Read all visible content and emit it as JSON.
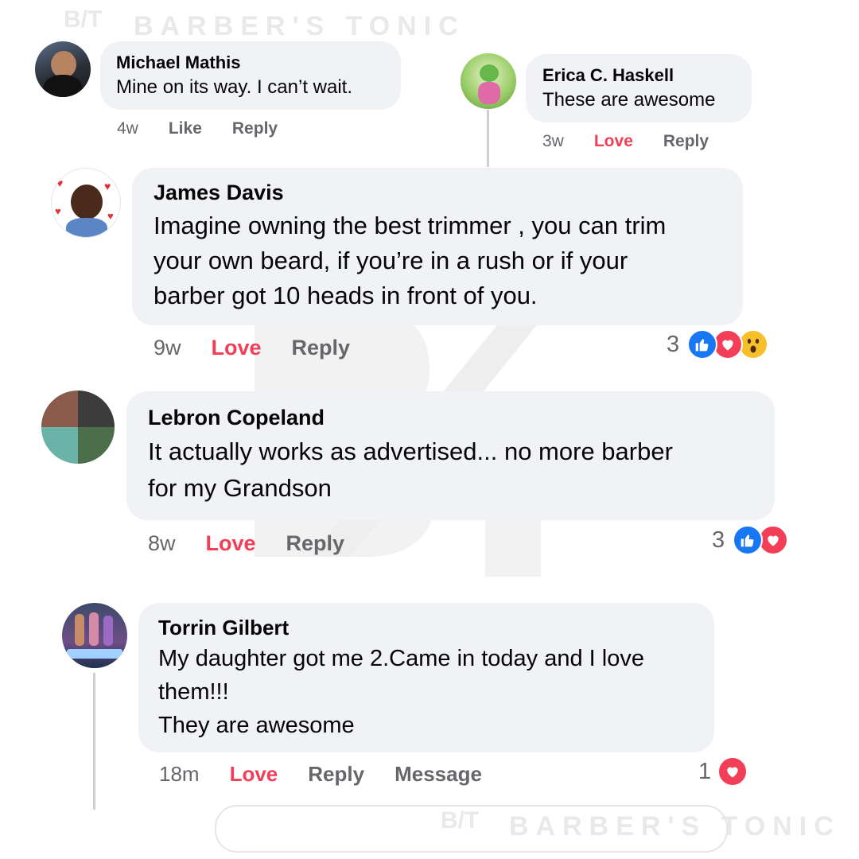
{
  "watermark": {
    "brand": "BARBER'S TONIC",
    "logo": "B/T"
  },
  "colors": {
    "bubble": "#f0f2f5",
    "love": "#f33e58",
    "like_blue": "#1877f2",
    "meta_gray": "#65676b"
  },
  "comments": [
    {
      "name": "Michael Mathis",
      "text": [
        "Mine on its way. I can’t wait."
      ],
      "time": "4w",
      "reaction_label": "Like",
      "reply": "Reply"
    },
    {
      "name": "Erica C. Haskell",
      "text": [
        "These are awesome"
      ],
      "time": "3w",
      "reaction_label": "Love",
      "reply": "Reply"
    },
    {
      "name": "James Davis",
      "text": [
        "Imagine owning the best trimmer , you can trim",
        "your own beard, if you’re in a rush or if your",
        "barber got 10 heads in front of you."
      ],
      "time": "9w",
      "reaction_label": "Love",
      "reply": "Reply",
      "reaction_count": "3",
      "reaction_icons": [
        "like-icon",
        "love-icon",
        "wow-icon"
      ]
    },
    {
      "name": "Lebron Copeland",
      "text": [
        "It actually works as advertised... no more barber",
        "for my Grandson"
      ],
      "time": "8w",
      "reaction_label": "Love",
      "reply": "Reply",
      "reaction_count": "3",
      "reaction_icons": [
        "like-icon",
        "love-icon"
      ]
    },
    {
      "name": "Torrin Gilbert",
      "text": [
        "My daughter got me 2.Came in today and I love",
        "them!!!",
        "They are awesome"
      ],
      "time": "18m",
      "reaction_label": "Love",
      "reply": "Reply",
      "message": "Message",
      "reaction_count": "1",
      "reaction_icons": [
        "love-icon"
      ]
    }
  ]
}
